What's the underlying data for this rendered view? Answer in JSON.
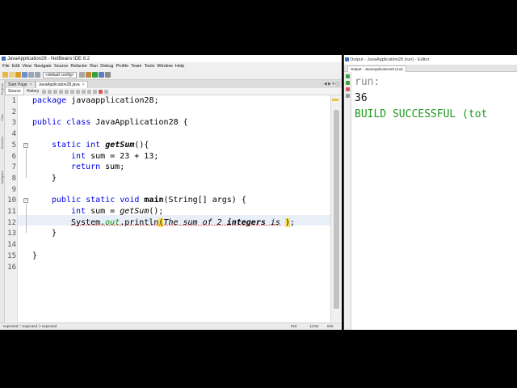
{
  "netbeans": {
    "window_title": "JavaApplication28 - NetBeans IDE 8.2",
    "menu": [
      "File",
      "Edit",
      "View",
      "Navigate",
      "Source",
      "Refactor",
      "Run",
      "Debug",
      "Profile",
      "Team",
      "Tools",
      "Window",
      "Help"
    ],
    "toolbar": {
      "config": "<default config>"
    },
    "tabs": [
      {
        "label": "Start Page",
        "active": false
      },
      {
        "label": "JavaApplication28.java",
        "active": true
      }
    ],
    "editor_views": [
      "Source",
      "History"
    ],
    "code": {
      "line_numbers": [
        "1",
        "2",
        "3",
        "4",
        "5",
        "6",
        "7",
        "8",
        "9",
        "10",
        "11",
        "12",
        "13",
        "14",
        "15",
        "16"
      ],
      "l1_kw": "package",
      "l1_rest": " javaapplication28;",
      "l3_kw": "public class",
      "l3_rest": " JavaApplication28 {",
      "l5_kw": "static int",
      "l5_name": "getSum",
      "l5_rest": "(){",
      "l6_kw": "int",
      "l6_rest": " sum = 23 + 13;",
      "l7_kw": "return",
      "l7_rest": " sum;",
      "l8": "}",
      "l10_kw": "public static void",
      "l10_name": "main",
      "l10_rest": "(String[] args) {",
      "l11_kw": "int",
      "l11_mid": " sum = ",
      "l11_call": "getSum",
      "l11_rest": "();",
      "l12_obj": "System.",
      "l12_field": "out",
      "l12_call": ".println",
      "l12_open": "(",
      "l12_str_a": "The sum of 2 ",
      "l12_str_b": "integers",
      "l12_str_c": " is ",
      "l12_close": ")",
      "l12_end": ";",
      "l13": "}",
      "l15": "}"
    },
    "status": {
      "message": "' expected  ';' expected  ')' expected",
      "insert": "INS",
      "position": "12:53",
      "mode": "INS"
    }
  },
  "output": {
    "window_title": "Output - JavaApplication28 (run) - Editor",
    "tab_label": "Output - JavaApplication28 (run)",
    "lines": [
      {
        "text": "run:",
        "color": "#8a8a8a"
      },
      {
        "text": "36",
        "color": "#111111"
      },
      {
        "text": "BUILD SUCCESSFUL (tot",
        "color": "#1f9a1f"
      }
    ]
  },
  "colors": {
    "keyword": "#0000e6",
    "string": "#009900",
    "paren_highlight": "#ffe14a",
    "current_line": "#e9eff8"
  }
}
